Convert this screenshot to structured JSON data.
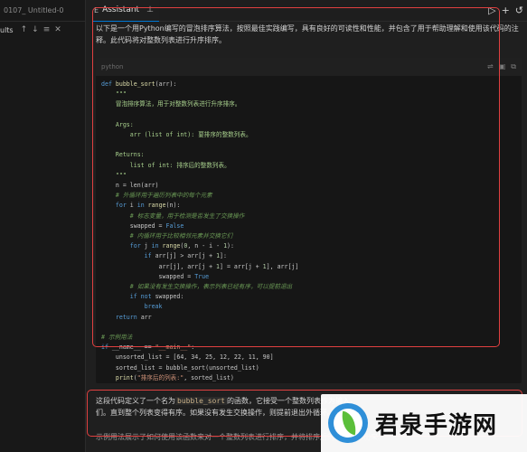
{
  "left": {
    "tab_label": "0107_ Untitled-0",
    "toolbar_label": "ults",
    "toolbar_icons": [
      "arrow-up-icon",
      "arrow-down-icon",
      "list-icon",
      "close-icon"
    ]
  },
  "panel": {
    "tab_title": "Assistant",
    "actions": [
      "run-icon",
      "add-icon",
      "history-icon"
    ]
  },
  "intro_text": "以下是一个用Python编写的冒泡排序算法，按照最佳实践编写，具有良好的可读性和性能，并包含了用于帮助理解和使用该代码的注释。此代码将对整数列表进行升序排序。",
  "code": {
    "language": "python",
    "lines": [
      [
        [
          "kw",
          "def "
        ],
        [
          "fn",
          "bubble_sort"
        ],
        [
          "t",
          "(arr):"
        ]
      ],
      [
        [
          "t",
          "    "
        ],
        [
          "doc",
          "\"\"\""
        ]
      ],
      [
        [
          "t",
          "    "
        ],
        [
          "doc",
          "冒泡排序算法，用于对整数列表进行升序排序。"
        ]
      ],
      [
        [
          "t",
          ""
        ]
      ],
      [
        [
          "t",
          "    "
        ],
        [
          "doc",
          "Args:"
        ]
      ],
      [
        [
          "t",
          "        "
        ],
        [
          "doc",
          "arr (list of int): 要排序的整数列表。"
        ]
      ],
      [
        [
          "t",
          ""
        ]
      ],
      [
        [
          "t",
          "    "
        ],
        [
          "doc",
          "Returns:"
        ]
      ],
      [
        [
          "t",
          "        "
        ],
        [
          "doc",
          "list of int: 排序后的整数列表。"
        ]
      ],
      [
        [
          "t",
          "    "
        ],
        [
          "doc",
          "\"\"\""
        ]
      ],
      [
        [
          "t",
          "    n = len(arr)"
        ]
      ],
      [
        [
          "t",
          "    "
        ],
        [
          "cm",
          "# 外循环用于遍历列表中的每个元素"
        ]
      ],
      [
        [
          "t",
          "    "
        ],
        [
          "kw",
          "for "
        ],
        [
          "t",
          "i "
        ],
        [
          "kw",
          "in "
        ],
        [
          "fn",
          "range"
        ],
        [
          "t",
          "(n):"
        ]
      ],
      [
        [
          "t",
          "        "
        ],
        [
          "cm",
          "# 标志变量，用于检测是否发生了交换操作"
        ]
      ],
      [
        [
          "t",
          "        swapped = "
        ],
        [
          "kw",
          "False"
        ]
      ],
      [
        [
          "t",
          "        "
        ],
        [
          "cm",
          "# 内循环用于比较相邻元素并交换它们"
        ]
      ],
      [
        [
          "t",
          "        "
        ],
        [
          "kw",
          "for "
        ],
        [
          "t",
          "j "
        ],
        [
          "kw",
          "in "
        ],
        [
          "fn",
          "range"
        ],
        [
          "t",
          "("
        ],
        [
          "num",
          "0"
        ],
        [
          "t",
          ", n - i - "
        ],
        [
          "num",
          "1"
        ],
        [
          "t",
          "):"
        ]
      ],
      [
        [
          "t",
          "            "
        ],
        [
          "kw",
          "if "
        ],
        [
          "t",
          "arr[j] > arr[j + "
        ],
        [
          "num",
          "1"
        ],
        [
          "t",
          "]:"
        ]
      ],
      [
        [
          "t",
          "                arr[j], arr[j + "
        ],
        [
          "num",
          "1"
        ],
        [
          "t",
          "] = arr[j + "
        ],
        [
          "num",
          "1"
        ],
        [
          "t",
          "], arr[j]"
        ]
      ],
      [
        [
          "t",
          "                swapped = "
        ],
        [
          "kw",
          "True"
        ]
      ],
      [
        [
          "t",
          "        "
        ],
        [
          "cm",
          "# 如果没有发生交换操作，表示列表已经有序，可以提前退出"
        ]
      ],
      [
        [
          "t",
          "        "
        ],
        [
          "kw",
          "if not "
        ],
        [
          "t",
          "swapped:"
        ]
      ],
      [
        [
          "t",
          "            "
        ],
        [
          "kw",
          "break"
        ]
      ],
      [
        [
          "t",
          "    "
        ],
        [
          "kw",
          "return "
        ],
        [
          "t",
          "arr"
        ]
      ],
      [
        [
          "t",
          ""
        ]
      ],
      [
        [
          "cm",
          "# 示例用法"
        ]
      ],
      [
        [
          "kw",
          "if "
        ],
        [
          "t",
          "__name__ == "
        ],
        [
          "str",
          "\"__main__\""
        ],
        [
          "t",
          ":"
        ]
      ],
      [
        [
          "t",
          "    unsorted_list = [64, 34, 25, 12, 22, 11, 90]"
        ]
      ],
      [
        [
          "t",
          "    sorted_list = bubble_sort(unsorted_list)"
        ]
      ],
      [
        [
          "t",
          "    "
        ],
        [
          "fn",
          "print"
        ],
        [
          "t",
          "("
        ],
        [
          "str",
          "\"排序后的列表:\""
        ],
        [
          "t",
          ", sorted_list)"
        ]
      ]
    ]
  },
  "explanation": {
    "before": "这段代码定义了一个名为",
    "code_term": "bubble_sort",
    "after": "的函数，它接受一个整数列表作为输入，",
    "line2": "们。直到整个列表变得有序。如果没有发生交换操作，则提前退出外循环。"
  },
  "example_note": "示例用法展示了如何使用该函数来对一个整数列表进行排序，并将排序后的结果打印出来。",
  "watermark": {
    "text": "君泉手游网"
  }
}
